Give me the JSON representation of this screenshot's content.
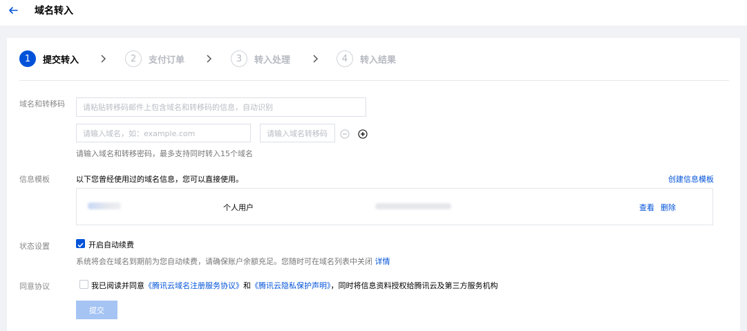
{
  "header": {
    "title": "域名转入",
    "back_icon": "arrow-left-icon"
  },
  "steps": [
    {
      "num": "1",
      "label": "提交转入",
      "active": true
    },
    {
      "num": "2",
      "label": "支付订单",
      "active": false
    },
    {
      "num": "3",
      "label": "转入处理",
      "active": false
    },
    {
      "num": "4",
      "label": "转入结果",
      "active": false
    }
  ],
  "domain_section": {
    "label": "域名和转移码",
    "paste_placeholder": "请粘贴转移码邮件上包含域名和转移码的信息，自动识别",
    "domain_placeholder": "请输入域名，如：example.com",
    "code_placeholder": "请输入域名转移码",
    "hint": "请输入域名和转移密码，最多支持同时转入15个域名"
  },
  "template_section": {
    "label": "信息模板",
    "intro": "以下您曾经使用过的域名信息，您可以直接使用。",
    "create_link": "创建信息模板",
    "row": {
      "type": "个人用户",
      "view": "查看",
      "delete": "删除"
    }
  },
  "status_section": {
    "label": "状态设置",
    "auto_renew_label": "开启自动续费",
    "auto_renew_checked": true,
    "hint": "系统将会在域名到期前为您自动续费，请确保账户余额充足。您随时可在域名列表中关闭",
    "hint_link": "详情"
  },
  "agreement_section": {
    "label": "同意协议",
    "checked": false,
    "prefix": "我已阅读并同意",
    "link1": "《腾讯云域名注册服务协议》",
    "middle": "和",
    "link2": "《腾讯云隐私保护声明》",
    "suffix": "，同时将信息资料授权给腾讯云及第三方服务机构"
  },
  "submit_label": "提交",
  "colors": {
    "primary": "#0052d9",
    "disabled_button": "#a5c4f4",
    "background": "#f1f2f5"
  }
}
